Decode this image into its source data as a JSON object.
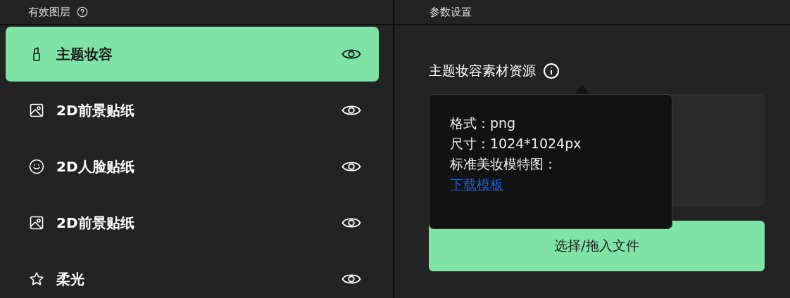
{
  "layers_panel": {
    "title": "有效图层",
    "items": [
      {
        "label": "主题妆容",
        "kind": "lipstick",
        "selected": true,
        "visible": true
      },
      {
        "label": "2D前景贴纸",
        "kind": "image",
        "selected": false,
        "visible": true
      },
      {
        "label": "2D人脸贴纸",
        "kind": "face",
        "selected": false,
        "visible": true
      },
      {
        "label": "2D前景贴纸",
        "kind": "image",
        "selected": false,
        "visible": true
      },
      {
        "label": "柔光",
        "kind": "star",
        "selected": false,
        "visible": true
      }
    ]
  },
  "settings_panel": {
    "title": "参数设置",
    "field_label": "主题妆容素材资源",
    "tooltip": {
      "lines": [
        "格式：png",
        "尺寸：1024*1024px",
        "标准美妆模特图："
      ],
      "link": "下载模板"
    },
    "upload_button": "选择/拖入文件"
  }
}
